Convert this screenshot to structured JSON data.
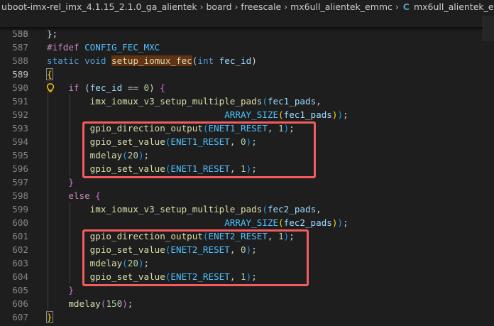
{
  "breadcrumb": {
    "parts": [
      "uboot-imx-rel_imx_4.1.15_2.1.0_ga_alientek",
      "board",
      "freescale",
      "mx6ull_alientek_emmc"
    ],
    "file_icon": "C",
    "file": "mx6ull_alientek_emmc.c"
  },
  "sticky": {
    "line_number": "553",
    "directive": "#ifdef",
    "macro": "CONFIG_FEC_MXC"
  },
  "lines": [
    {
      "n": "586",
      "tokens": [
        [
          "p",
          "}"
        ],
        [
          "p",
          ";"
        ]
      ]
    },
    {
      "n": "587",
      "tokens": []
    },
    {
      "n": "588",
      "tokens": [
        [
          "kw",
          "static"
        ],
        [
          "p",
          " "
        ],
        [
          "kw",
          "void"
        ],
        [
          "p",
          " "
        ],
        [
          "hlfn",
          "setup_iomux_fec"
        ],
        [
          "p",
          "("
        ],
        [
          "kw",
          "int"
        ],
        [
          "p",
          " "
        ],
        [
          "param",
          "fec_id"
        ],
        [
          "p",
          ")"
        ]
      ]
    },
    {
      "n": "589",
      "active": true,
      "tokens": [
        [
          "hlbr",
          "{"
        ]
      ]
    },
    {
      "n": "590",
      "tokens": [
        [
          "p",
          "    "
        ],
        [
          "ctl",
          "if"
        ],
        [
          "p",
          " ("
        ],
        [
          "param",
          "fec_id"
        ],
        [
          "p",
          " == "
        ],
        [
          "num",
          "0"
        ],
        [
          "p",
          ") "
        ],
        [
          "br2",
          "{"
        ]
      ]
    },
    {
      "n": "591",
      "tokens": [
        [
          "p",
          "        "
        ],
        [
          "fn",
          "imx_iomux_v3_setup_multiple_pads"
        ],
        [
          "br3",
          "("
        ],
        [
          "param",
          "fec1_pads"
        ],
        [
          "p",
          ","
        ]
      ]
    },
    {
      "n": "592",
      "tokens": [
        [
          "p",
          "                                 "
        ],
        [
          "macro",
          "ARRAY_SIZE"
        ],
        [
          "br1",
          "("
        ],
        [
          "param",
          "fec1_pads"
        ],
        [
          "br1",
          ")"
        ],
        [
          "br3",
          ")"
        ],
        [
          "p",
          ";"
        ]
      ]
    },
    {
      "n": "593",
      "tokens": [
        [
          "p",
          "        "
        ],
        [
          "fn",
          "gpio_direction_output"
        ],
        [
          "br3",
          "("
        ],
        [
          "macro",
          "ENET1_RESET"
        ],
        [
          "p",
          ", "
        ],
        [
          "num",
          "1"
        ],
        [
          "br3",
          ")"
        ],
        [
          "p",
          ";"
        ]
      ]
    },
    {
      "n": "594",
      "tokens": [
        [
          "p",
          "        "
        ],
        [
          "fn",
          "gpio_set_value"
        ],
        [
          "br3",
          "("
        ],
        [
          "macro",
          "ENET1_RESET"
        ],
        [
          "p",
          ", "
        ],
        [
          "num",
          "0"
        ],
        [
          "br3",
          ")"
        ],
        [
          "p",
          ";"
        ]
      ]
    },
    {
      "n": "595",
      "tokens": [
        [
          "p",
          "        "
        ],
        [
          "fn",
          "mdelay"
        ],
        [
          "br3",
          "("
        ],
        [
          "num",
          "20"
        ],
        [
          "br3",
          ")"
        ],
        [
          "p",
          ";"
        ]
      ]
    },
    {
      "n": "596",
      "tokens": [
        [
          "p",
          "        "
        ],
        [
          "fn",
          "gpio_set_value"
        ],
        [
          "br3",
          "("
        ],
        [
          "macro",
          "ENET1_RESET"
        ],
        [
          "p",
          ", "
        ],
        [
          "num",
          "1"
        ],
        [
          "br3",
          ")"
        ],
        [
          "p",
          ";"
        ]
      ]
    },
    {
      "n": "597",
      "tokens": [
        [
          "p",
          "    "
        ],
        [
          "br2",
          "}"
        ]
      ]
    },
    {
      "n": "598",
      "tokens": [
        [
          "p",
          "    "
        ],
        [
          "ctl",
          "else"
        ],
        [
          "p",
          " "
        ],
        [
          "br2",
          "{"
        ]
      ]
    },
    {
      "n": "599",
      "tokens": [
        [
          "p",
          "        "
        ],
        [
          "fn",
          "imx_iomux_v3_setup_multiple_pads"
        ],
        [
          "br3",
          "("
        ],
        [
          "param",
          "fec2_pads"
        ],
        [
          "p",
          ","
        ]
      ]
    },
    {
      "n": "600",
      "tokens": [
        [
          "p",
          "                                 "
        ],
        [
          "macro",
          "ARRAY_SIZE"
        ],
        [
          "br1",
          "("
        ],
        [
          "param",
          "fec2_pads"
        ],
        [
          "br1",
          ")"
        ],
        [
          "br3",
          ")"
        ],
        [
          "p",
          ";"
        ]
      ]
    },
    {
      "n": "601",
      "tokens": [
        [
          "p",
          "        "
        ],
        [
          "fn",
          "gpio_direction_output"
        ],
        [
          "br3",
          "("
        ],
        [
          "macro",
          "ENET2_RESET"
        ],
        [
          "p",
          ", "
        ],
        [
          "num",
          "1"
        ],
        [
          "br3",
          ")"
        ],
        [
          "p",
          ";"
        ]
      ]
    },
    {
      "n": "602",
      "tokens": [
        [
          "p",
          "        "
        ],
        [
          "fn",
          "gpio_set_value"
        ],
        [
          "br3",
          "("
        ],
        [
          "macro",
          "ENET2_RESET"
        ],
        [
          "p",
          ", "
        ],
        [
          "num",
          "0"
        ],
        [
          "br3",
          ")"
        ],
        [
          "p",
          ";"
        ]
      ]
    },
    {
      "n": "603",
      "tokens": [
        [
          "p",
          "        "
        ],
        [
          "fn",
          "mdelay"
        ],
        [
          "br3",
          "("
        ],
        [
          "num",
          "20"
        ],
        [
          "br3",
          ")"
        ],
        [
          "p",
          ";"
        ]
      ]
    },
    {
      "n": "604",
      "tokens": [
        [
          "p",
          "        "
        ],
        [
          "fn",
          "gpio_set_value"
        ],
        [
          "br3",
          "("
        ],
        [
          "macro",
          "ENET2_RESET"
        ],
        [
          "p",
          ", "
        ],
        [
          "num",
          "1"
        ],
        [
          "br3",
          ")"
        ],
        [
          "p",
          ";"
        ]
      ]
    },
    {
      "n": "605",
      "tokens": [
        [
          "p",
          "    "
        ],
        [
          "br2",
          "}"
        ]
      ]
    },
    {
      "n": "606",
      "tokens": [
        [
          "p",
          "    "
        ],
        [
          "fn",
          "mdelay"
        ],
        [
          "br2",
          "("
        ],
        [
          "num",
          "150"
        ],
        [
          "br2",
          ")"
        ],
        [
          "p",
          ";"
        ]
      ]
    },
    {
      "n": "607",
      "tokens": [
        [
          "hlbr",
          "}"
        ]
      ]
    }
  ],
  "icons": {
    "lightbulb": "lightbulb-icon",
    "file": "c-file-icon",
    "separator": "chevron-right-icon"
  },
  "colors": {
    "background": "#1e1e1e",
    "annotation": "#f35b5e",
    "highlight": "#613214"
  }
}
